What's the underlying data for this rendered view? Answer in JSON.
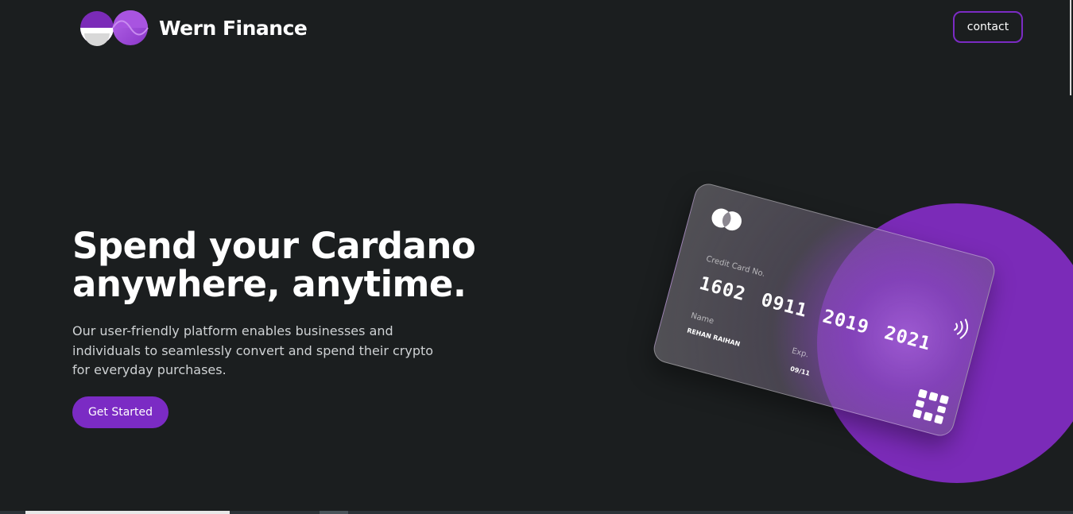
{
  "header": {
    "brand": "Wern Finance",
    "contact_label": "contact",
    "logo_icon": "wern-logo-icon"
  },
  "hero": {
    "title_line1": "Spend your Cardano",
    "title_line2": "anywhere, anytime.",
    "description": "Our user-friendly platform enables businesses and individuals to seamlessly convert and spend their crypto for everyday purchases.",
    "cta_label": "Get Started"
  },
  "card": {
    "label": "Credit Card No.",
    "number_groups": [
      "1602",
      "0911",
      "2019",
      "2021"
    ],
    "name_label": "Name",
    "name_value": "REHAN RAIHAN",
    "exp_label": "Exp.",
    "exp_value": "09/11",
    "icons": [
      "mastercard-icon",
      "contactless-icon",
      "chip-icon"
    ]
  },
  "colors": {
    "background": "#1b1e1f",
    "accent": "#7b2bc4",
    "circle": "#7b2bb8",
    "text_muted": "#cfd2d4"
  }
}
